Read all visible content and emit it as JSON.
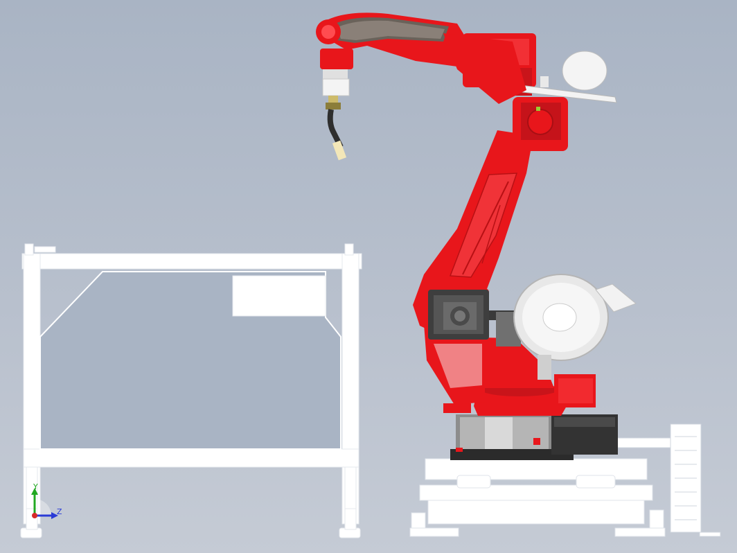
{
  "viewport": {
    "background_top": "#a9b4c4",
    "background_bottom": "#c5cbd5"
  },
  "robot": {
    "body_color": "#e8161b",
    "shadow_color": "#a30f12",
    "dark_color": "#3a3a3a",
    "base_metal_color": "#8a8a8a",
    "wire_feeder_color": "#f4f4f4"
  },
  "fixture": {
    "frame_color": "#ffffff"
  },
  "triad": {
    "y_label": "Y",
    "z_label": "Z",
    "y_color": "#21a821",
    "z_color": "#2a3bd6",
    "x_color": "#d62a2a"
  }
}
